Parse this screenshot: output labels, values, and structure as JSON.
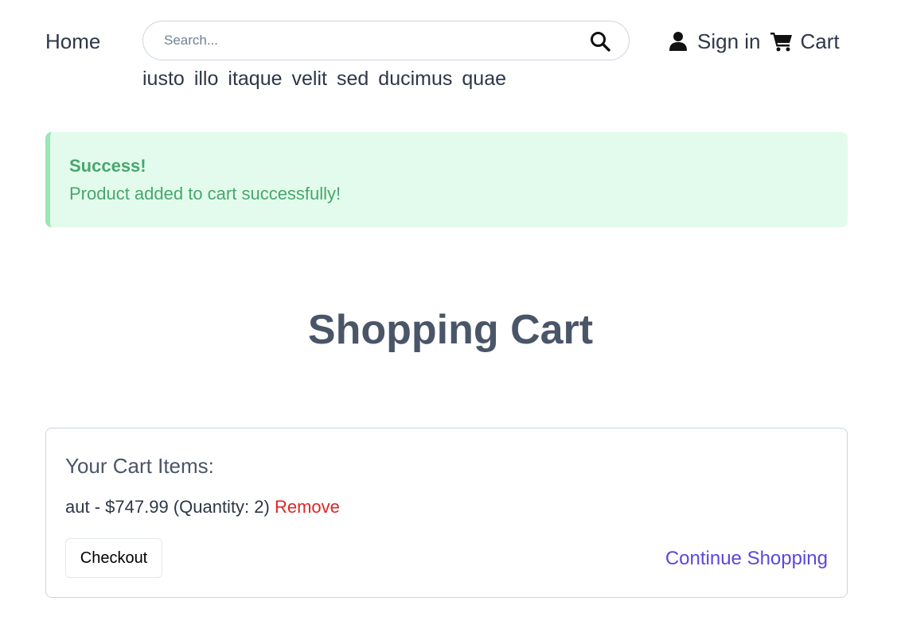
{
  "header": {
    "home_label": "Home",
    "search": {
      "placeholder": "Search...",
      "value": ""
    },
    "search_icon": "search-icon",
    "tags": [
      "iusto",
      "illo",
      "itaque",
      "velit",
      "sed",
      "ducimus",
      "quae"
    ],
    "signin_label": "Sign in",
    "signin_icon": "user-icon",
    "cart_label": "Cart",
    "cart_icon": "shopping-cart-icon"
  },
  "alert": {
    "title": "Success!",
    "message": "Product added to cart successfully!",
    "colors": {
      "background": "#e3fbec",
      "border": "#9ae6b4",
      "text": "#48a66e"
    }
  },
  "page": {
    "title": "Shopping Cart"
  },
  "cart": {
    "heading": "Your Cart Items:",
    "items": [
      {
        "name": "aut",
        "separator": " - ",
        "price": "$747.99",
        "quantity_text": " (Quantity: 2) ",
        "remove_label": "Remove"
      }
    ],
    "checkout_label": "Checkout",
    "continue_label": "Continue Shopping",
    "colors": {
      "remove": "#dc2626",
      "continue": "#5a48d9"
    }
  }
}
